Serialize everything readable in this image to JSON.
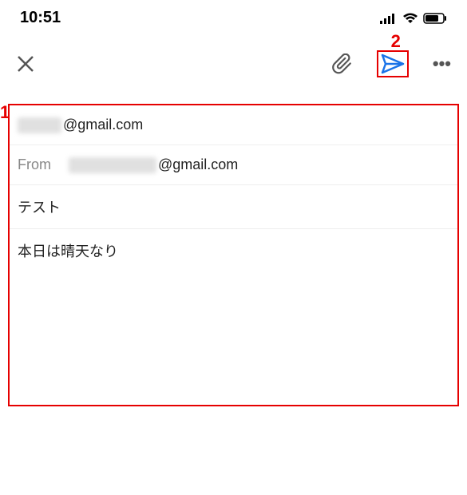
{
  "statusBar": {
    "time": "10:51"
  },
  "toolbar": {
    "annotation1": "1",
    "annotation2": "2"
  },
  "compose": {
    "to_suffix": "@gmail.com",
    "from_label": "From",
    "from_suffix": "@gmail.com",
    "subject": "テスト",
    "body": "本日は晴天なり"
  }
}
